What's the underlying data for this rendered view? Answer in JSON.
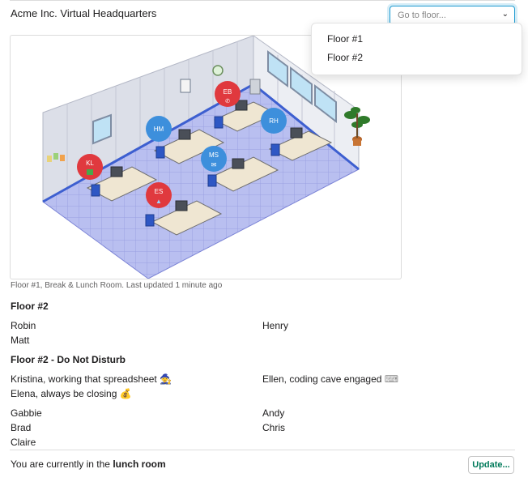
{
  "header": {
    "title": "Acme Inc. Virtual Headquarters",
    "floor_select_placeholder": "Go to floor..."
  },
  "floor_menu": [
    "Floor #1",
    "Floor #2"
  ],
  "map": {
    "avatars": [
      {
        "initials": "EB",
        "color": "#e0393e",
        "icon": "phone-icon"
      },
      {
        "initials": "HM",
        "color": "#3d8fdc"
      },
      {
        "initials": "RH",
        "color": "#3d8fdc"
      },
      {
        "initials": "MS",
        "color": "#3d8fdc",
        "icon": "mail-icon"
      },
      {
        "initials": "KL",
        "color": "#e0393e",
        "icon": "trash-icon"
      },
      {
        "initials": "ES",
        "color": "#e0393e",
        "icon": "rocket-icon"
      }
    ],
    "caption": "Floor #1, Break & Lunch Room. Last updated 1 minute ago"
  },
  "sections": [
    {
      "heading": "Floor #2",
      "col1": [
        "Robin",
        "Matt"
      ],
      "col2": [
        "Henry"
      ]
    },
    {
      "heading": "Floor #2 - Do Not Disturb",
      "col1": [
        {
          "text": "Kristina, working that spreadsheet",
          "emoji": "🧙"
        },
        {
          "text": "Elena, always be closing",
          "emoji": "💰"
        }
      ],
      "col2": [
        {
          "text": "Ellen, coding cave engaged",
          "emoji": "⌨"
        }
      ]
    },
    {
      "heading": "",
      "col1": [
        "Gabbie",
        "Brad",
        "Claire"
      ],
      "col2": [
        "Andy",
        "Chris"
      ]
    }
  ],
  "footer": {
    "status_prefix": "You are currently in the ",
    "status_location": "lunch room",
    "update_label": "Update..."
  },
  "colors": {
    "link_green": "#007a5a",
    "focus_blue": "#1d9bd1",
    "dnd_red": "#e0393e",
    "active_blue": "#3d8fdc"
  }
}
